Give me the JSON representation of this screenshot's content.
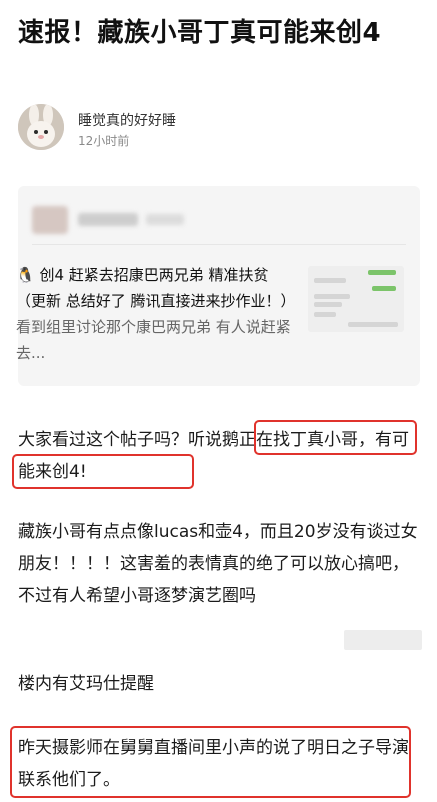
{
  "post": {
    "title": "速报！藏族小哥丁真可能来创4"
  },
  "author": {
    "name": "睡觉真的好好睡",
    "time": "12小时前"
  },
  "quote": {
    "penguin_icon": "🐧",
    "title_text": "创4 赶紧去招康巴两兄弟 精准扶贫 （更新 总结好了 腾讯直接进来抄作业！）",
    "excerpt": "看到组里讨论那个康巴两兄弟 有人说赶紧去..."
  },
  "body": {
    "para1_part1": "大家看过这个帖子吗？听说",
    "para1_part2": "鹅正在找丁真小哥，有可能来创4!",
    "para2": "藏族小哥有点点像lucas和壶4，而且20岁没有谈过女朋友！！！！这害羞的表情真的绝了可以放心搞吧，不过有人希望小哥逐梦演艺圈吗",
    "para3": "楼内有艾玛仕提醒",
    "para4": "昨天摄影师在舅舅直播间里小声的说了明日之子导演联系他们了。"
  },
  "colors": {
    "highlight": "#e0332c",
    "quote_bg": "#f5f5f5"
  }
}
